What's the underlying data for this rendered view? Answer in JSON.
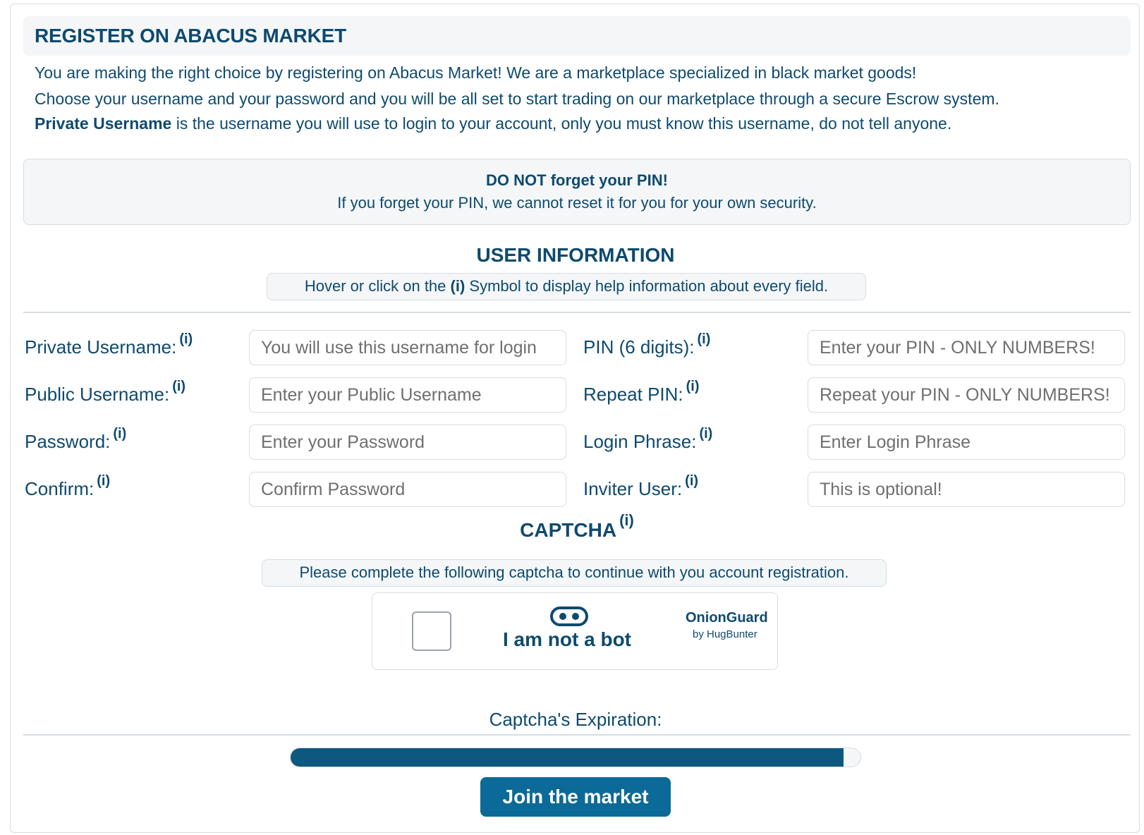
{
  "header": {
    "title": "REGISTER ON ABACUS MARKET"
  },
  "intro": {
    "line1": "You are making the right choice by registering on Abacus Market! We are a marketplace specialized in black market goods!",
    "line2": "Choose your username and your password and you will be all set to start trading on our marketplace through a secure Escrow system.",
    "line3_bold": "Private Username",
    "line3_rest": " is the username you will use to login to your account, only you must know this username, do not tell anyone."
  },
  "warning": {
    "title": "DO NOT forget your PIN!",
    "text": "If you forget your PIN, we cannot reset it for you for your own security."
  },
  "user_info": {
    "title": "USER INFORMATION",
    "hint_before": "Hover or click on the ",
    "hint_symbol": "(i)",
    "hint_after": " Symbol to display help information about every field."
  },
  "info_symbol": "(i)",
  "fields_left": [
    {
      "label": "Private Username:",
      "placeholder": "You will use this username for login",
      "value": ""
    },
    {
      "label": "Public Username:",
      "placeholder": "Enter your Public Username",
      "value": ""
    },
    {
      "label": "Password:",
      "placeholder": "Enter your Password",
      "value": ""
    },
    {
      "label": "Confirm:",
      "placeholder": "Confirm Password",
      "value": ""
    }
  ],
  "fields_right": [
    {
      "label": "PIN (6 digits):",
      "placeholder": "Enter your PIN - ONLY NUMBERS!",
      "value": ""
    },
    {
      "label": "Repeat PIN:",
      "placeholder": "Repeat your PIN - ONLY NUMBERS!",
      "value": ""
    },
    {
      "label": "Login Phrase:",
      "placeholder": "Enter Login Phrase",
      "value": ""
    },
    {
      "label": "Inviter User:",
      "placeholder": "This is optional!",
      "value": ""
    }
  ],
  "captcha": {
    "title": "CAPTCHA",
    "hint": "Please complete the following captcha to continue with you account registration.",
    "checkbox_label": "I am not a bot",
    "checked": false,
    "brand": "OnionGuard",
    "brand_by": "by HugBunter",
    "icon": "robot-face-icon"
  },
  "expiration": {
    "label": "Captcha's Expiration:",
    "remaining_fraction": 0.97
  },
  "submit": {
    "label": "Join the market"
  },
  "colors": {
    "primary": "#0e4a6e",
    "button": "#0c6a98",
    "progress": "#0c587f",
    "panel_bg": "#f4f6f8",
    "border": "#d7dde2"
  }
}
